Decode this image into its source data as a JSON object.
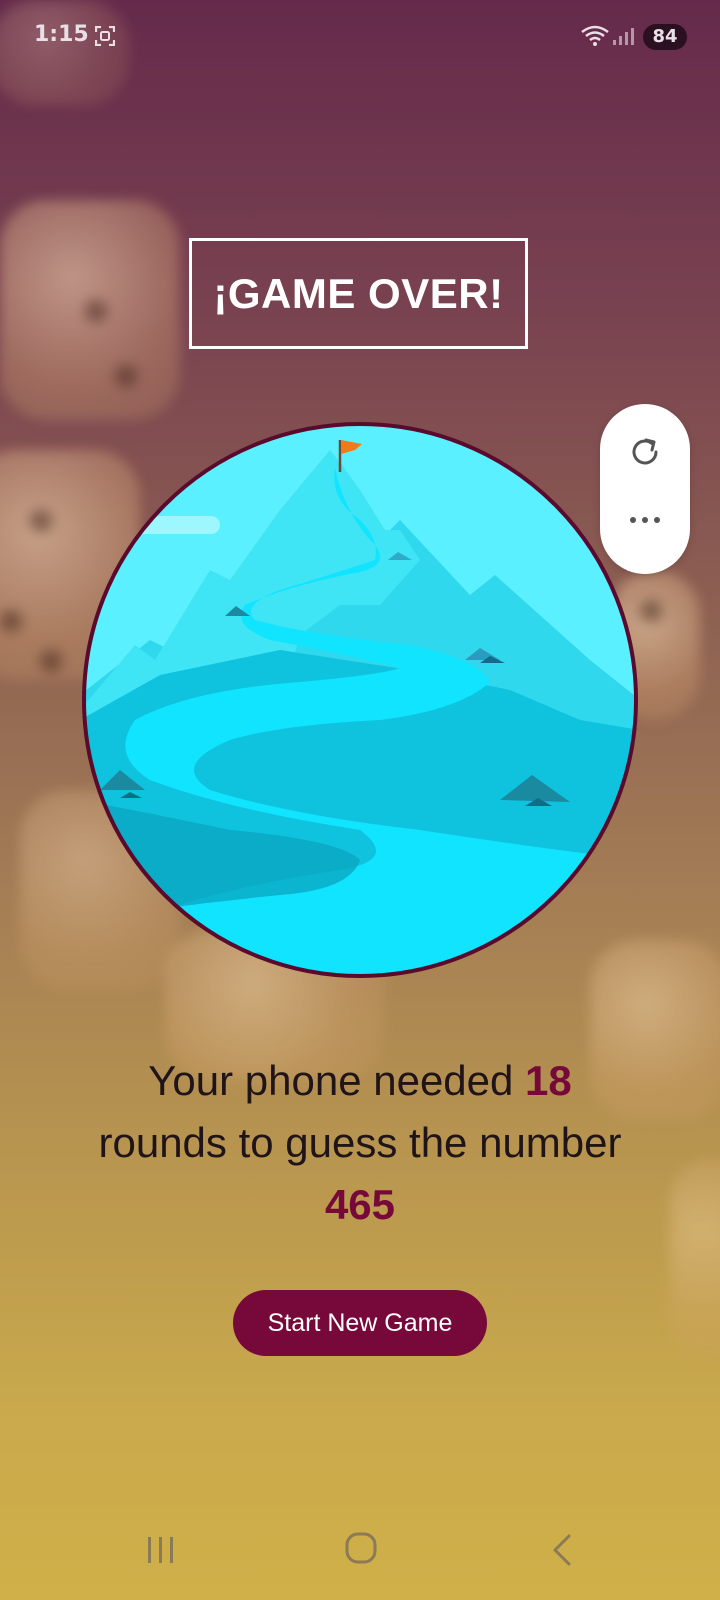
{
  "status_bar": {
    "time": "1:15",
    "battery": "84"
  },
  "title": "¡GAME OVER!",
  "result": {
    "text_before": "Your phone needed ",
    "rounds": "18",
    "text_middle": "rounds to guess the number",
    "number": "465"
  },
  "start_button_label": "Start New Game",
  "colors": {
    "accent": "#76093a",
    "circle_border": "#5a0a2c",
    "sky": "#5bf0ff",
    "flag": "#f07a1a"
  },
  "icons": {
    "panel": [
      "refresh-icon",
      "more-icon"
    ],
    "nav": [
      "recent-apps-icon",
      "home-icon",
      "back-icon"
    ]
  }
}
